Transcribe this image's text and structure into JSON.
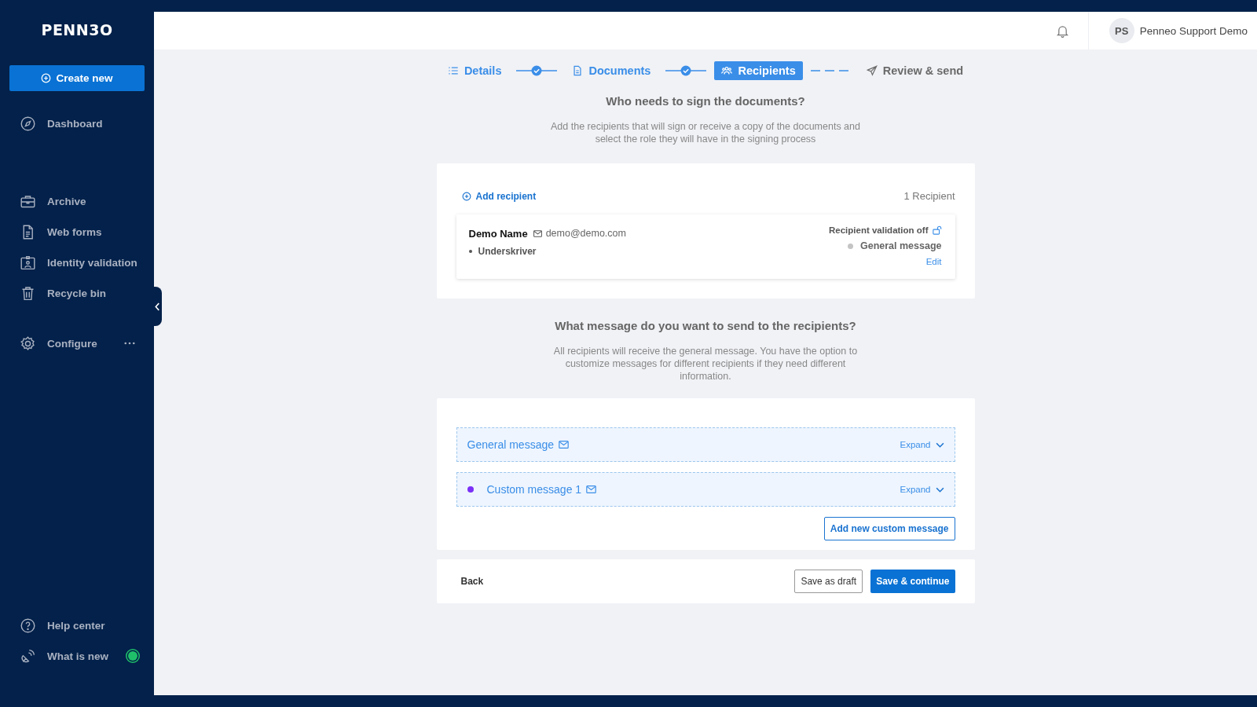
{
  "sidebar": {
    "logo": "PENN3O",
    "create_button": "Create new",
    "sections": [
      [
        {
          "label": "Dashboard",
          "kind": "compass"
        }
      ],
      [
        {
          "label": "Archive",
          "kind": "briefcase"
        },
        {
          "label": "Web forms",
          "kind": "document"
        },
        {
          "label": "Identity validation",
          "kind": "id-card"
        },
        {
          "label": "Recycle bin",
          "kind": "trash"
        }
      ],
      [
        {
          "label": "Configure",
          "kind": "gear",
          "more": true
        }
      ]
    ],
    "bottom_items": [
      {
        "label": "Help center",
        "kind": "help",
        "has_news": false
      },
      {
        "label": "What is new",
        "kind": "satellite",
        "has_news": true
      }
    ]
  },
  "header": {
    "avatar_initials": "PS",
    "user_name": "Penneo Support Demo"
  },
  "steps": [
    {
      "label": "Details",
      "kind": "list",
      "selected": false,
      "completed": true
    },
    {
      "label": "Documents",
      "kind": "file",
      "selected": false,
      "completed": true
    },
    {
      "label": "Recipients",
      "kind": "people",
      "selected": true,
      "completed": false
    },
    {
      "label": "Review & send",
      "kind": "send",
      "selected": false,
      "completed": false
    }
  ],
  "recipients_section": {
    "title": "Who needs to sign the documents?",
    "description": "Add the recipients that will sign or receive a copy of the documents and select the role they will have in the signing process",
    "add_link": "Add recipient",
    "count": "1 Recipient",
    "recipients": [
      {
        "name": "Demo Name",
        "email": "demo@demo.com",
        "role": "Underskriver",
        "validation": "Recipient validation off",
        "message": "General message",
        "color": "#c4c4c4",
        "edit": "Edit"
      }
    ]
  },
  "messages_section": {
    "title": "What message do you want to send to the recipients?",
    "description": "All recipients will receive the general message. You have the option to customize messages for different recipients if they need different information.",
    "messages": [
      {
        "label": "General message",
        "expand": "Expand"
      },
      {
        "label": "Custom message 1",
        "color": "#7b2ff7",
        "expand": "Expand"
      }
    ],
    "add_button": "Add new custom message"
  },
  "footer": {
    "back": "Back",
    "save_draft": "Save as draft",
    "save_continue": "Save & continue"
  }
}
